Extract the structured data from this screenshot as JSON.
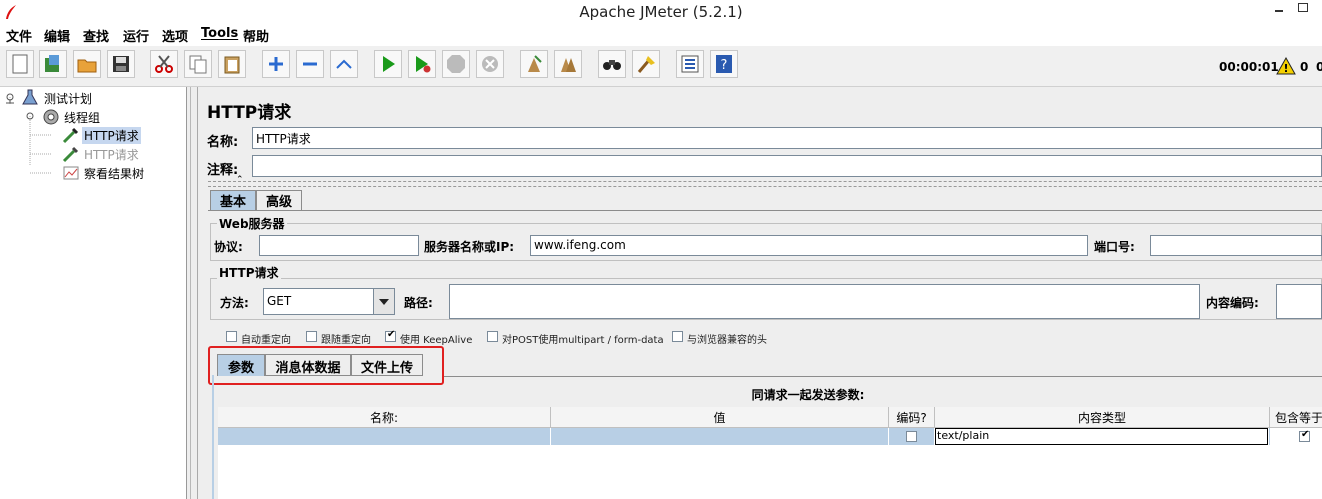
{
  "window": {
    "title": "Apache JMeter (5.2.1)",
    "minimize": "▫",
    "restore": "▣"
  },
  "menu": [
    "文件",
    "编辑",
    "查找",
    "运行",
    "选项",
    "Tools",
    "帮助"
  ],
  "toolbar": {
    "timer": "00:00:01",
    "warn_count": "0",
    "extra_count": "0",
    "icons": [
      "new-icon",
      "templates-icon",
      "open-icon",
      "save-icon",
      "cut-icon",
      "copy-icon",
      "paste-icon",
      "expand-icon",
      "collapse-icon",
      "toggle-icon",
      "start-icon",
      "start-no-pause-icon",
      "stop-icon",
      "shutdown-icon",
      "clear-icon",
      "clear-all-icon",
      "search-icon",
      "reset-search-icon",
      "function-helper-icon",
      "help-icon"
    ]
  },
  "tree": {
    "plan": "测试计划",
    "thread_group": "线程组",
    "sampler1": "HTTP请求",
    "sampler2": "HTTP请求",
    "listener": "察看结果树"
  },
  "panel": {
    "title": "HTTP请求",
    "name_label": "名称:",
    "name_value": "HTTP请求",
    "comment_label": "注释:",
    "comment_value": "",
    "tabs": [
      "基本",
      "高级"
    ],
    "web_server": {
      "legend": "Web服务器",
      "protocol_label": "协议:",
      "protocol_value": "",
      "server_label": "服务器名称或IP:",
      "server_value": "www.ifeng.com",
      "port_label": "端口号:",
      "port_value": ""
    },
    "http_request": {
      "legend": "HTTP请求",
      "method_label": "方法:",
      "method_value": "GET",
      "path_label": "路径:",
      "path_value": "",
      "encoding_label": "内容编码:",
      "encoding_value": ""
    },
    "options": [
      {
        "label": "自动重定向",
        "checked": false
      },
      {
        "label": "跟随重定向",
        "checked": false
      },
      {
        "label": "使用 KeepAlive",
        "checked": true
      },
      {
        "label": "对POST使用multipart / form-data",
        "checked": false
      },
      {
        "label": "与浏览器兼容的头",
        "checked": false
      }
    ],
    "sub_tabs": [
      "参数",
      "消息体数据",
      "文件上传"
    ],
    "params_title": "同请求一起发送参数:",
    "table": {
      "headers": [
        "名称:",
        "值",
        "编码?",
        "内容类型",
        "包含等于"
      ],
      "row": {
        "name": "",
        "value": "",
        "encode": false,
        "content_type": "text/plain",
        "include_equals": true
      }
    }
  }
}
